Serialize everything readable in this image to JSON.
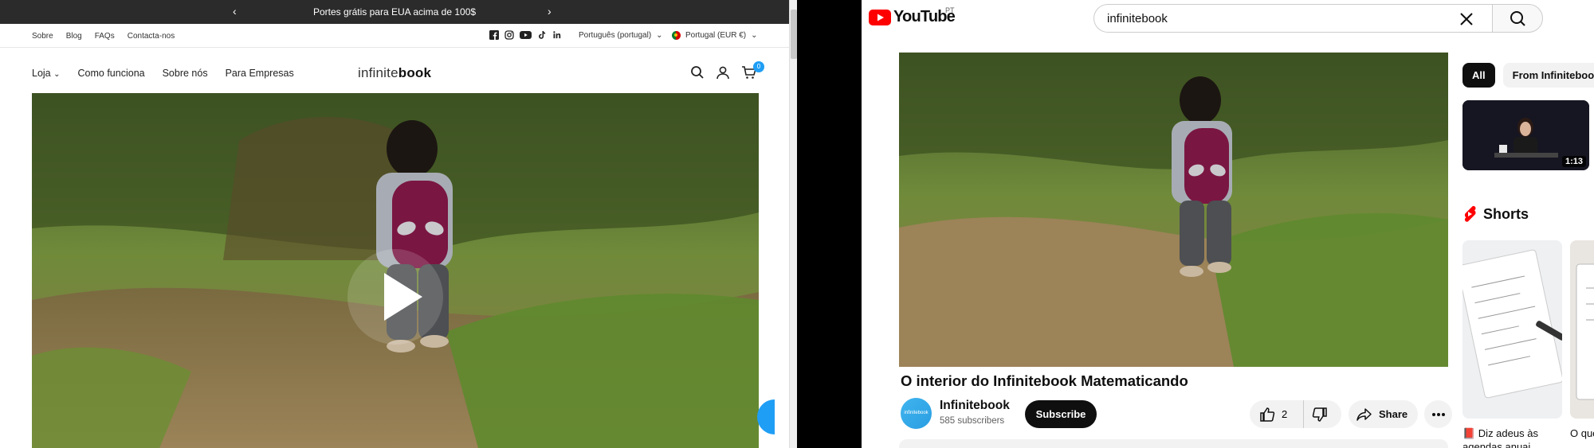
{
  "shop": {
    "announcement": "Portes grátis para EUA acima de 100$",
    "utility_links": [
      "Sobre",
      "Blog",
      "FAQs",
      "Contacta-nos"
    ],
    "language": "Português (portugal)",
    "country": "Portugal (EUR €)",
    "nav_items": [
      "Loja",
      "Como funciona",
      "Sobre nós",
      "Para Empresas"
    ],
    "logo_light": "infinite",
    "logo_bold": "book",
    "cart_count": "0",
    "social_icons": [
      "facebook-icon",
      "instagram-icon",
      "youtube-icon",
      "tiktok-icon",
      "linkedin-icon"
    ]
  },
  "youtube": {
    "logo_text": "YouTube",
    "region": "PT",
    "search_query": "infinitebook",
    "video_title": "O interior do Infinitebook Matematicando",
    "channel_name": "Infinitebook",
    "subscribers": "585 subscribers",
    "subscribe_label": "Subscribe",
    "like_count": "2",
    "share_label": "Share",
    "avatar_text": "infinitebook",
    "chips": [
      "All",
      "From Infinitebook"
    ],
    "rec_duration": "1:13",
    "shorts_label": "Shorts",
    "shorts": [
      {
        "title": "📕 Diz adeus às agendas anuai"
      },
      {
        "title": "O que Infinit"
      }
    ],
    "colors": {
      "brand_red": "#ff0000",
      "accent_blue": "#1f9ef5"
    }
  }
}
